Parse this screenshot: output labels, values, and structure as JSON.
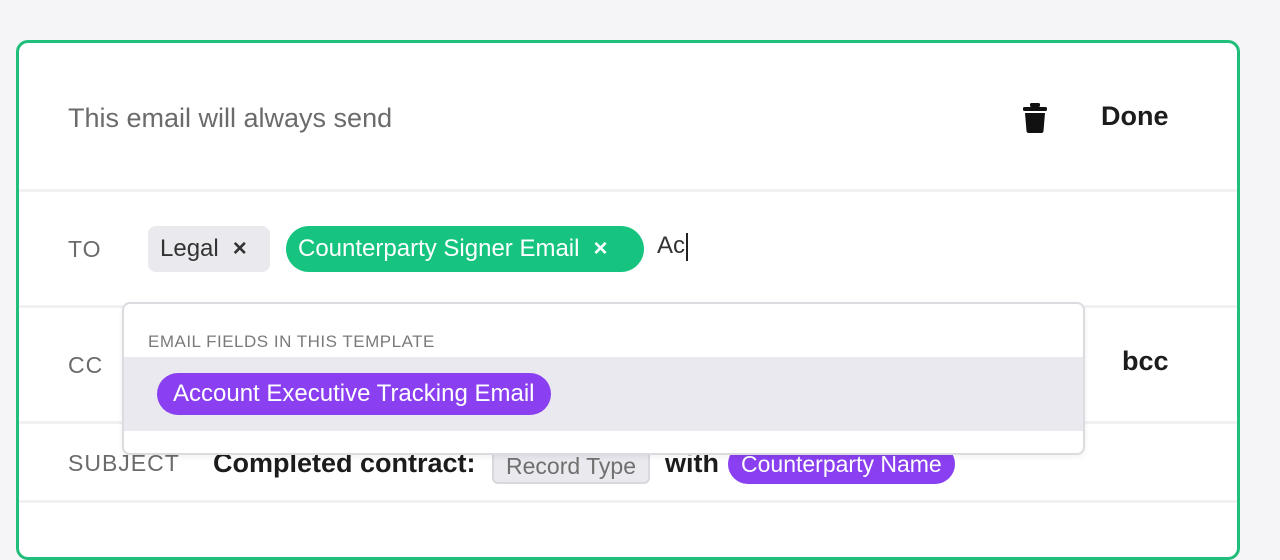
{
  "header": {
    "text": "This email will always send",
    "done_label": "Done"
  },
  "to": {
    "label": "TO",
    "recipients": [
      {
        "label": "Legal",
        "style": "gray",
        "remove": "×"
      },
      {
        "label": "Counterparty Signer Email",
        "style": "green",
        "remove": "×"
      }
    ],
    "typed_value": "Ac"
  },
  "cc": {
    "label": "CC",
    "bcc_label": "bcc"
  },
  "subject": {
    "label": "SUBJECT",
    "prefix": "Completed contract:",
    "token1": "Record Type",
    "joiner": "with",
    "token2": "Counterparty Name"
  },
  "dropdown": {
    "heading": "EMAIL FIELDS IN THIS TEMPLATE",
    "options": [
      {
        "label": "Account Executive Tracking Email"
      }
    ]
  },
  "icons": {
    "trash": "trash-icon",
    "remove": "close-icon"
  },
  "colors": {
    "border_accent": "#1fbf7b",
    "green_chip": "#16c47f",
    "purple_token": "#8a3ff0",
    "gray_chip": "#e9e9ee"
  }
}
